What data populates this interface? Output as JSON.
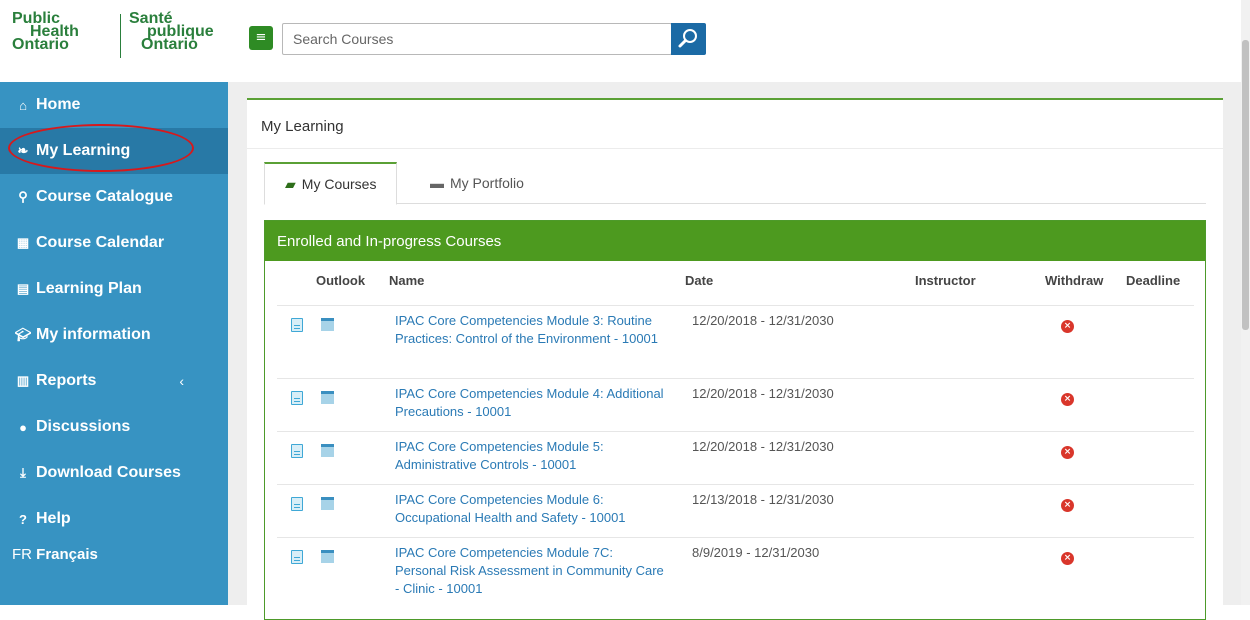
{
  "logo": {
    "en_line1": "Public",
    "en_line2": "Health",
    "en_line3": "Ontario",
    "fr_line1": "Santé",
    "fr_line2": "publique",
    "fr_line3": "Ontario"
  },
  "header": {
    "menu_icon": "hamburger-icon",
    "search_placeholder": "Search Courses",
    "search_icon": "magnifier-icon"
  },
  "sidebar": {
    "items": [
      {
        "label": "Home",
        "icon": "home-icon"
      },
      {
        "label": "My Learning",
        "icon": "leaf-icon"
      },
      {
        "label": "Course Catalogue",
        "icon": "search-icon"
      },
      {
        "label": "Course Calendar",
        "icon": "calendar-icon"
      },
      {
        "label": "Learning Plan",
        "icon": "file-icon"
      },
      {
        "label": "My information",
        "icon": "graduation-cap-icon"
      },
      {
        "label": "Reports",
        "icon": "bar-chart-icon"
      },
      {
        "label": "Discussions",
        "icon": "comments-icon"
      },
      {
        "label": "Download Courses",
        "icon": "download-icon"
      },
      {
        "label": "Help",
        "icon": "question-icon"
      }
    ],
    "lang_prefix": "FR",
    "lang_label": "Français"
  },
  "main": {
    "title": "My Learning",
    "tabs": [
      {
        "label": "My Courses",
        "icon": "book-icon"
      },
      {
        "label": "My Portfolio",
        "icon": "briefcase-icon"
      }
    ],
    "section_title": "Enrolled and In-progress Courses",
    "columns": {
      "outlook": "Outlook",
      "name": "Name",
      "date": "Date",
      "instructor": "Instructor",
      "withdraw": "Withdraw",
      "deadline": "Deadline"
    },
    "rows": [
      {
        "name": "IPAC Core Competencies Module 3: Routine Practices: Control of the Environment - 10001",
        "date": "12/20/2018 - 12/31/2030"
      },
      {
        "name": "IPAC Core Competencies Module 4: Additional Precautions - 10001",
        "date": "12/20/2018 - 12/31/2030"
      },
      {
        "name": "IPAC Core Competencies Module 5: Administrative Controls - 10001",
        "date": "12/20/2018 - 12/31/2030"
      },
      {
        "name": "IPAC Core Competencies Module 6: Occupational Health and Safety - 10001",
        "date": "12/13/2018 - 12/31/2030"
      },
      {
        "name": "IPAC Core Competencies Module 7C: Personal Risk Assessment in Community Care - Clinic - 10001",
        "date": "8/9/2019 - 12/31/2030"
      }
    ],
    "withdraw_glyph": "×"
  }
}
